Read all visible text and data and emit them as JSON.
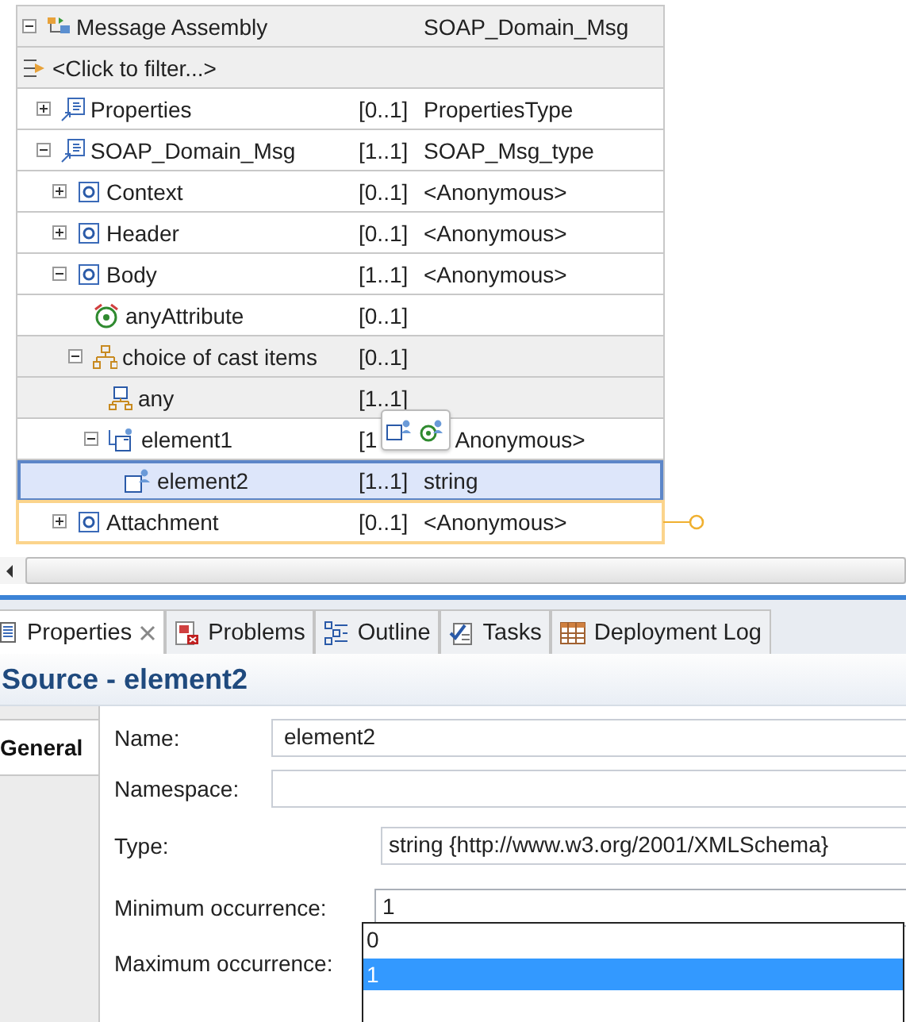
{
  "tree": {
    "header": {
      "name": "Message Assembly",
      "type": "SOAP_Domain_Msg",
      "expanded": true
    },
    "filter": "<Click to filter...>",
    "rows": [
      {
        "kind": "reference",
        "name": "Properties",
        "cardinality": "[0..1]",
        "type": "PropertiesType",
        "expanded": false,
        "selected": false,
        "shaded": false
      },
      {
        "kind": "reference",
        "name": "SOAP_Domain_Msg",
        "cardinality": "[1..1]",
        "type": "SOAP_Msg_type",
        "expanded": true,
        "selected": false,
        "shaded": false,
        "children": [
          {
            "kind": "element",
            "name": "Context",
            "cardinality": "[0..1]",
            "type": "<Anonymous>",
            "expanded": false,
            "selected": false,
            "shaded": false
          },
          {
            "kind": "element",
            "name": "Header",
            "cardinality": "[0..1]",
            "type": "<Anonymous>",
            "expanded": false,
            "selected": false,
            "shaded": false
          },
          {
            "kind": "element",
            "name": "Body",
            "cardinality": "[1..1]",
            "type": "<Anonymous>",
            "expanded": true,
            "selected": false,
            "shaded": false,
            "children": [
              {
                "kind": "attribute-wildcard",
                "name": "anyAttribute",
                "cardinality": "[0..1]",
                "selected": false,
                "shaded": false
              },
              {
                "kind": "choice",
                "name": "choice of cast items",
                "cardinality": "[0..1]",
                "expanded": true,
                "selected": false,
                "shaded": true,
                "children": [
                  {
                    "kind": "any",
                    "name": "any",
                    "cardinality": "[1..1]",
                    "selected": false,
                    "shaded": true
                  },
                  {
                    "kind": "local-element",
                    "name": "element1",
                    "cardinality": "[1",
                    "type": "Anonymous>",
                    "expanded": true,
                    "selected": false,
                    "shaded": false,
                    "popup": true,
                    "children": [
                      {
                        "kind": "user-element",
                        "name": "element2",
                        "cardinality": "[1..1]",
                        "type": "string",
                        "selected": true,
                        "shaded": false
                      }
                    ]
                  }
                ]
              }
            ]
          },
          {
            "kind": "element",
            "name": "Attachment",
            "cardinality": "[0..1]",
            "type": "<Anonymous>",
            "expanded": false,
            "selected": false,
            "shaded": false,
            "focused": true
          }
        ]
      }
    ]
  },
  "tabs": [
    {
      "label": "Properties",
      "selected": true,
      "kind": "properties"
    },
    {
      "label": "Problems",
      "selected": false,
      "kind": "problems"
    },
    {
      "label": "Outline",
      "selected": false,
      "kind": "outline"
    },
    {
      "label": "Tasks",
      "selected": false,
      "kind": "tasks"
    },
    {
      "label": "Deployment Log",
      "selected": false,
      "kind": "log"
    }
  ],
  "properties": {
    "title": "Source - element2",
    "sections": [
      {
        "label": "General",
        "selected": true
      }
    ],
    "fields": [
      {
        "kind": "text",
        "label": "Name:",
        "value": "element2"
      },
      {
        "kind": "text",
        "label": "Namespace:"
      },
      {
        "kind": "type",
        "label": "Type:",
        "value": "string {http://www.w3.org/2001/XMLSchema}"
      },
      {
        "kind": "combo",
        "label": "Minimum occurrence:",
        "value": "1"
      },
      {
        "kind": "covered",
        "label": "Maximum occurrence:"
      }
    ],
    "dropdown": {
      "options": [
        {
          "label": "0",
          "selected": false
        },
        {
          "label": "1",
          "selected": true
        }
      ]
    }
  }
}
